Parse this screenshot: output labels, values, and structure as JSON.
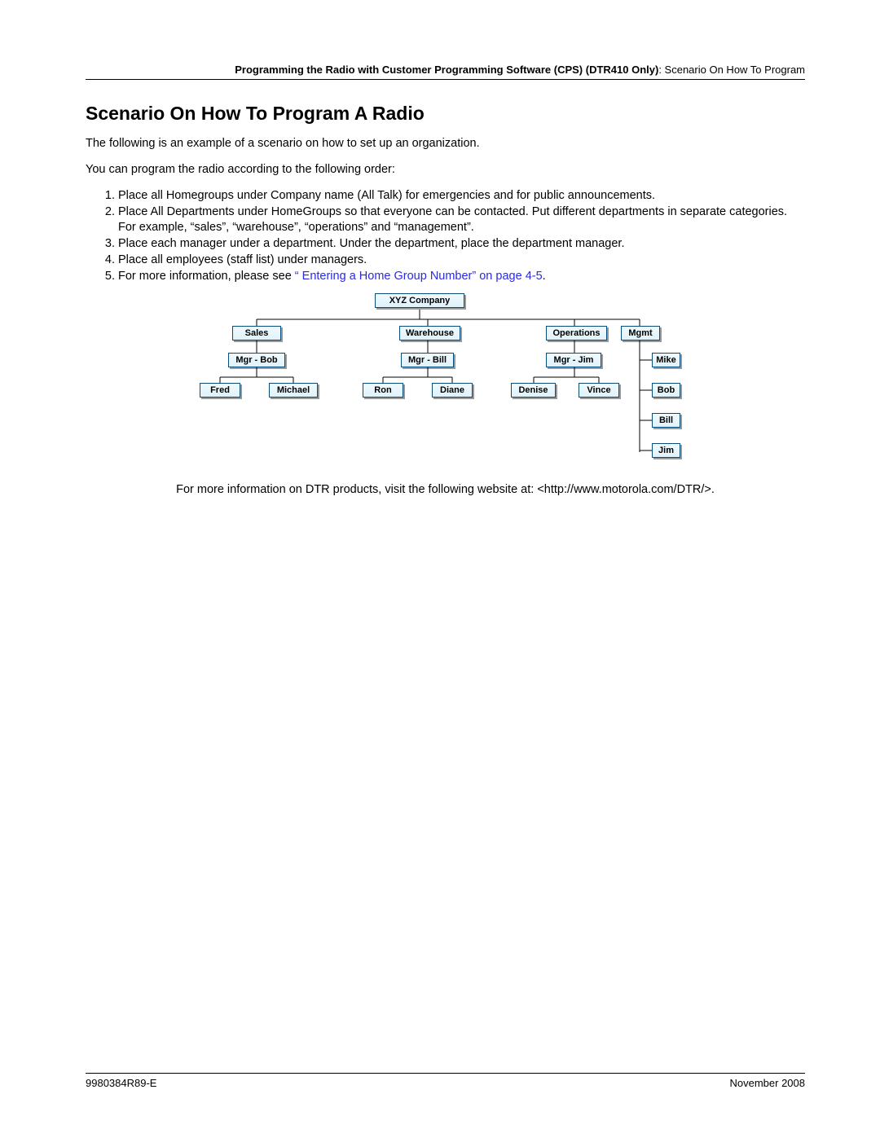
{
  "breadcrumb": {
    "bold": "Programming the Radio with Customer Programming Software (CPS) (DTR410 Only)",
    "tail": ": Scenario On How To Program"
  },
  "heading": "Scenario On How To Program A Radio",
  "intro1": "The following is an example of a scenario on how to set up an organization.",
  "intro2": "You can program the radio according to the following order:",
  "list": {
    "i1": "Place all Homegroups under Company name (All Talk) for emergencies and for public announcements.",
    "i2": "Place All Departments under HomeGroups so that everyone can be contacted. Put different departments in separate categories. For example, “sales”, “warehouse”, “operations” and “management”.",
    "i3": "Place each manager under a department. Under the department, place the department manager.",
    "i4": "Place all employees (staff list) under managers.",
    "i5a": "For more information, please see ",
    "i5link": "“ Entering a Home Group Number” on page 4-5",
    "i5b": "."
  },
  "chart_data": {
    "type": "tree",
    "title": "XYZ Company",
    "children": [
      {
        "name": "Sales",
        "children": [
          {
            "name": "Mgr - Bob",
            "children": [
              {
                "name": "Fred"
              },
              {
                "name": "Michael"
              }
            ]
          }
        ]
      },
      {
        "name": "Warehouse",
        "children": [
          {
            "name": "Mgr - Bill",
            "children": [
              {
                "name": "Ron"
              },
              {
                "name": "Diane"
              }
            ]
          }
        ]
      },
      {
        "name": "Operations",
        "children": [
          {
            "name": "Mgr - Jim",
            "children": [
              {
                "name": "Denise"
              },
              {
                "name": "Vince"
              }
            ]
          }
        ]
      },
      {
        "name": "Mgmt",
        "children": [
          {
            "name": "Mike"
          },
          {
            "name": "Bob"
          },
          {
            "name": "Bill"
          },
          {
            "name": "Jim"
          }
        ]
      }
    ]
  },
  "after": "For more information on DTR products, visit the following website at: <http://www.motorola.com/DTR/>.",
  "footer": {
    "left": "9980384R89-E",
    "right": "November 2008"
  }
}
